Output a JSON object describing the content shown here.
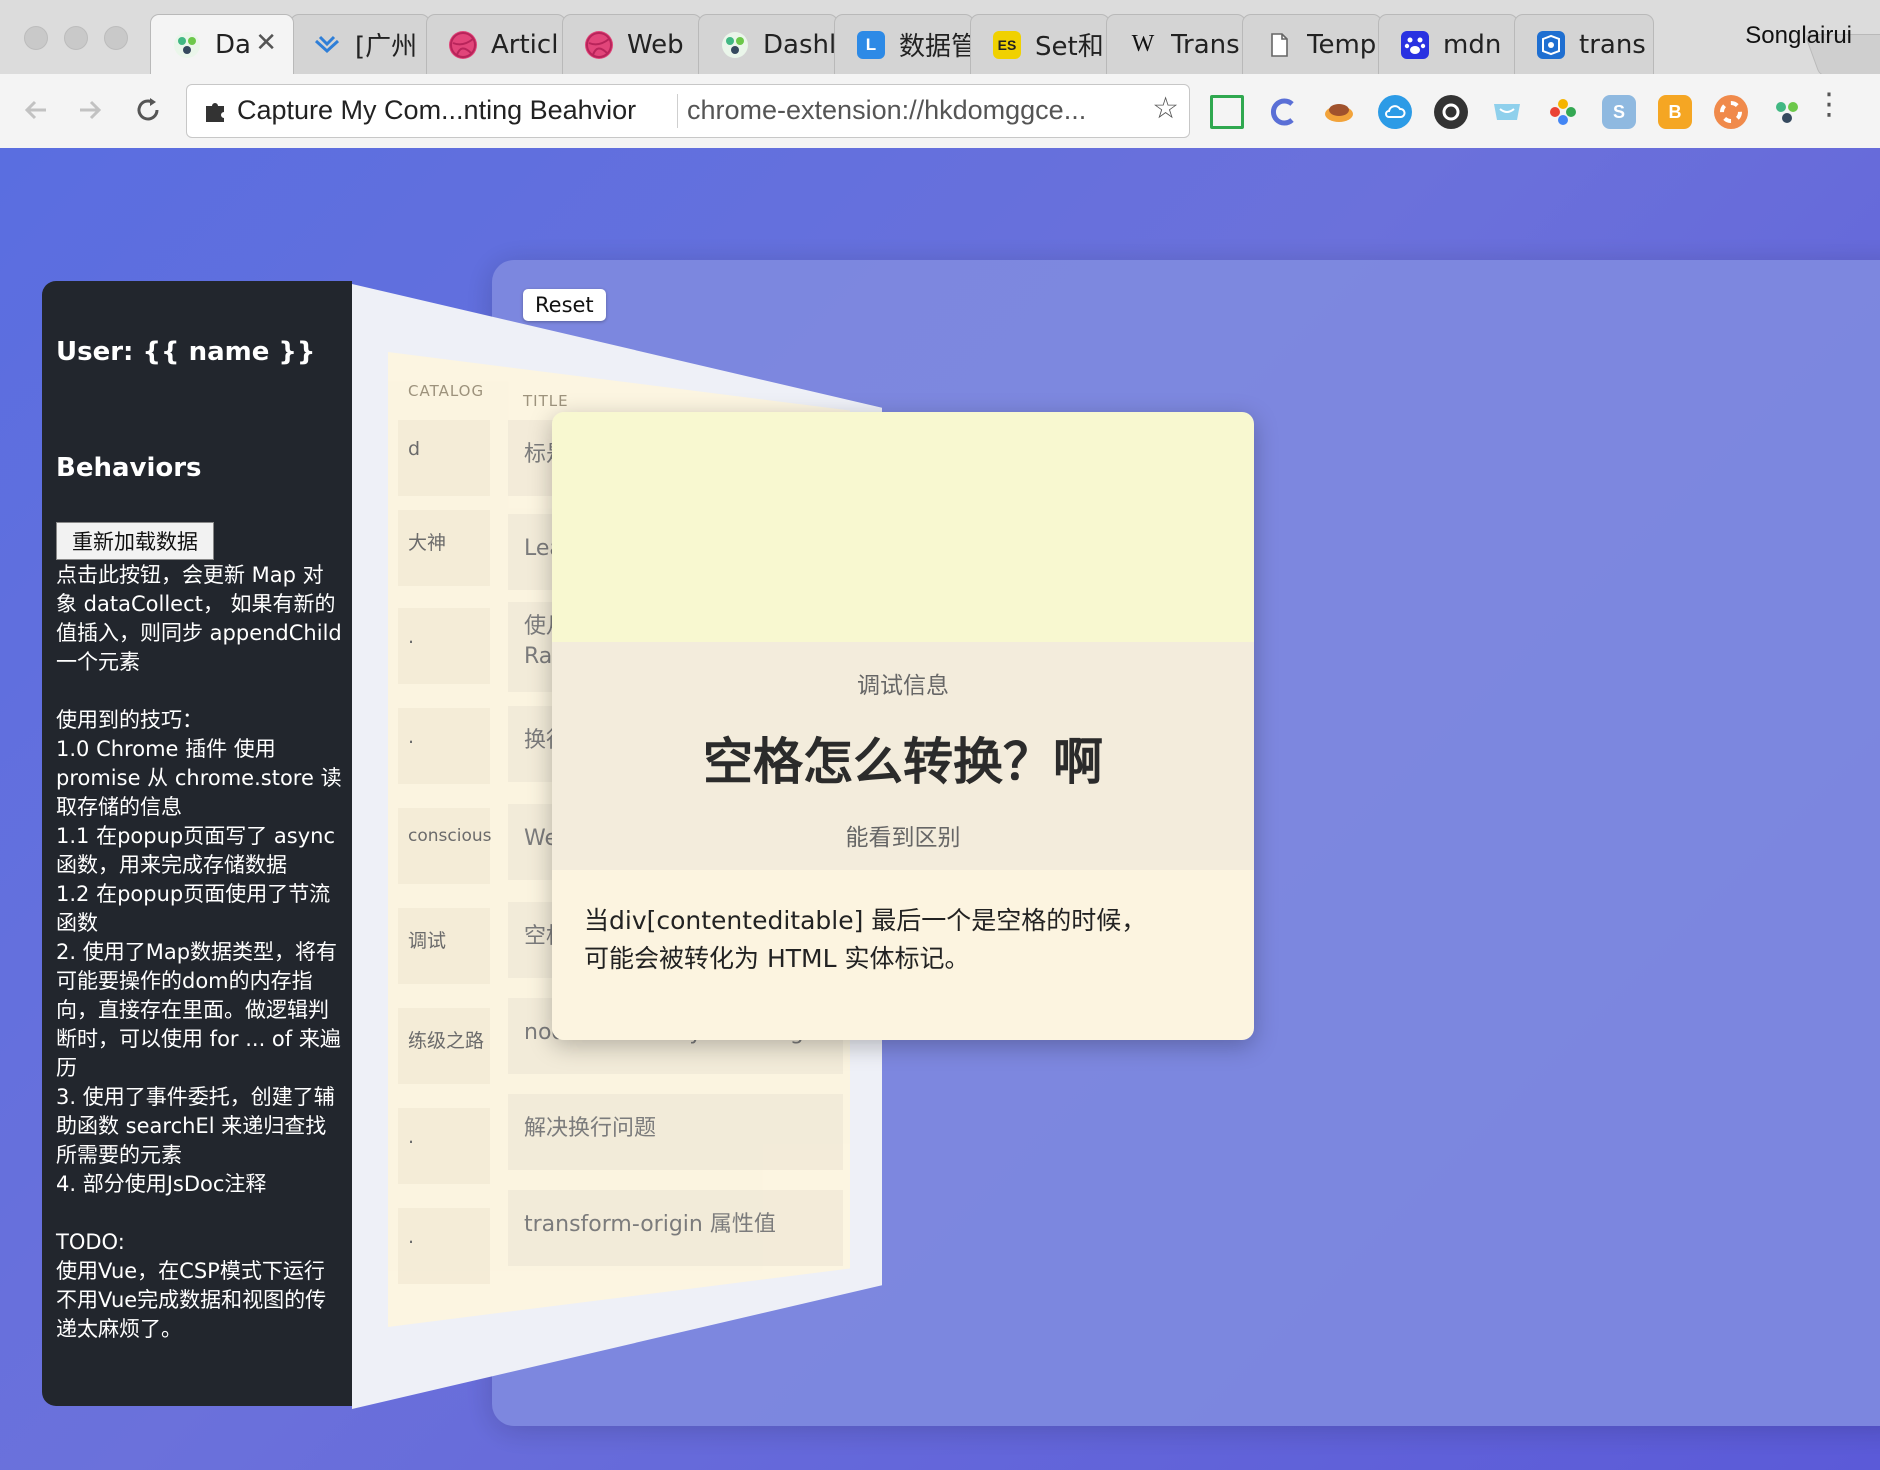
{
  "browser": {
    "tabs": [
      {
        "label": "Da",
        "icon": "vue-icon",
        "active": true
      },
      {
        "label": "[广州",
        "icon": "bird-icon"
      },
      {
        "label": "Articl",
        "icon": "dribbble-icon"
      },
      {
        "label": "Web",
        "icon": "dribbble-icon"
      },
      {
        "label": "Dashl",
        "icon": "vue-icon"
      },
      {
        "label": "数据管",
        "icon": "l-icon"
      },
      {
        "label": "Set和",
        "icon": "es-icon"
      },
      {
        "label": "Trans",
        "icon": "wikipedia-icon"
      },
      {
        "label": "Temp",
        "icon": "document-icon"
      },
      {
        "label": "mdn",
        "icon": "baidu-paw-icon"
      },
      {
        "label": "trans",
        "icon": "translate-icon"
      }
    ],
    "profile_name": "Songlairui",
    "omnibox": {
      "title": "Capture My Com...nting Beahvior",
      "url": "chrome-extension://hkdomggce..."
    },
    "tab_icon_text": {
      "l": "L",
      "es": "ES",
      "w": "W"
    },
    "ext_letters": {
      "s": "S",
      "b": "B"
    }
  },
  "sidebar": {
    "user": "User: {{ name }}",
    "behaviors": "Behaviors",
    "reload_button": "重新加载数据",
    "description": "点击此按钮，会更新 Map 对象 dataCollect， 如果有新的值插入，则同步 appendChild 一个元素\n\n使用到的技巧：\n1.0 Chrome 插件 使用 promise 从 chrome.store 读取存储的信息\n1.1 在popup页面写了 async 函数，用来完成存储数据\n1.2 在popup页面使用了节流函数\n2. 使用了Map数据类型，将有可能要操作的dom的内存指向，直接存在里面。做逻辑判断时，可以使用 for ... of 来遍历\n3. 使用了事件委托，创建了辅助函数 searchEl 来递归查找所需要的元素\n4. 部分使用JsDoc注释\n\nTODO:\n使用Vue，在CSP模式下运行\n不用Vue完成数据和视图的传递太麻烦了。"
  },
  "main": {
    "reset_button": "Reset",
    "table": {
      "headers": {
        "catalog": "CATALOG",
        "title": "TITLE"
      },
      "rows": [
        {
          "catalog": "d",
          "title": "标是"
        },
        {
          "catalog": "大神",
          "title": "Lea"
        },
        {
          "catalog": ".",
          "title": "使月\nRay"
        },
        {
          "catalog": ".",
          "title": "换行"
        },
        {
          "catalog": "conscious",
          "title": "We"
        },
        {
          "catalog": "调试",
          "title": "空格"
        },
        {
          "catalog": "练级之路",
          "title": "node-lessons by alsotang"
        },
        {
          "catalog": ".",
          "title": "解决换行问题"
        },
        {
          "catalog": ".",
          "title": "transform-origin 属性值"
        }
      ]
    },
    "detail": {
      "label": "调试信息",
      "title": "空格怎么转换？啊",
      "subtitle": "能看到区别",
      "body": "当div[contenteditable] 最后一个是空格的时候，\n可能会被转化为 HTML 实体标记。"
    }
  },
  "colors": {
    "page_gradient": [
      "#5a6ee0",
      "#5b5ad8"
    ],
    "sidebar_bg": "#22262d",
    "detail_header": "#f8f8d0",
    "detail_mid": "#f3ecdc",
    "detail_body": "#fcf4e0"
  }
}
